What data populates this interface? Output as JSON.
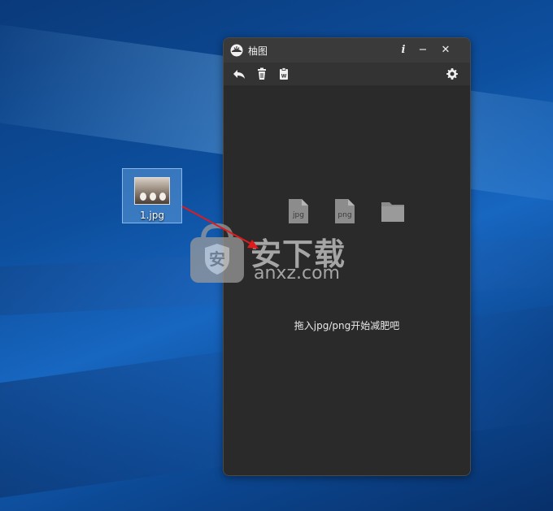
{
  "desktop": {
    "file_icon": {
      "label": "1.jpg"
    }
  },
  "window": {
    "title": "柚图",
    "controls": {
      "info": "i",
      "minimize": "−",
      "close": "✕"
    },
    "toolbar": {
      "items": [
        "undo-icon",
        "trash-icon",
        "clipboard-icon",
        "gear-icon"
      ]
    },
    "formats": [
      {
        "ext": "jpg",
        "icon": "file-icon"
      },
      {
        "ext": "png",
        "icon": "file-icon"
      },
      {
        "ext": "",
        "icon": "folder-icon"
      }
    ],
    "hint": "拖入jpg/png开始减肥吧"
  },
  "watermark": {
    "main": "安下载",
    "sub": "anxz.com"
  },
  "colors": {
    "window_bg": "#2b2b2b",
    "titlebar": "#3a3a3a",
    "desktop_blue": "#0d4f9e",
    "arrow": "#e01b1b"
  }
}
